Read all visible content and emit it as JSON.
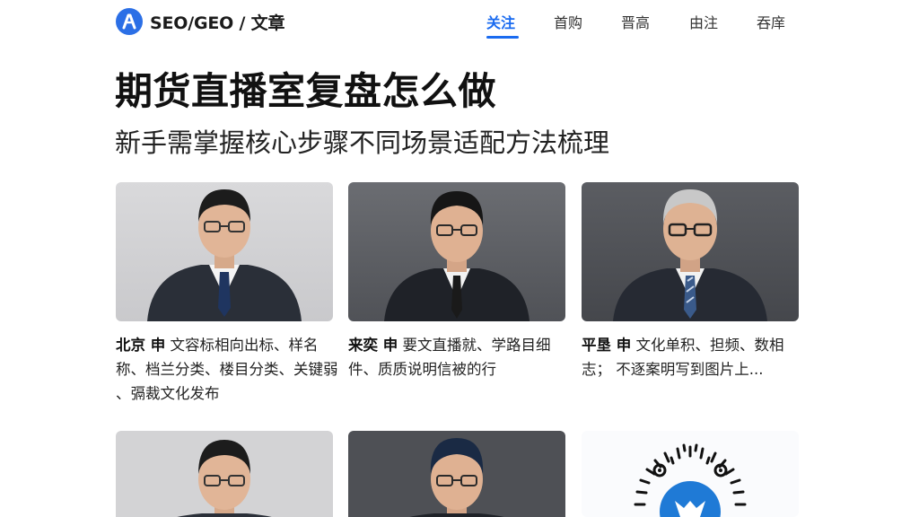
{
  "header": {
    "brand": "SEO/GEO / 文章",
    "nav": [
      {
        "label": "关注",
        "active": true
      },
      {
        "label": "首购",
        "active": false
      },
      {
        "label": "晋高",
        "active": false
      },
      {
        "label": "由注",
        "active": false
      },
      {
        "label": "吞庠",
        "active": false
      }
    ]
  },
  "article": {
    "title": "期货直播室复盘怎么做",
    "subtitle": "新手需掌握核心步骤不同场景适配方法梳理"
  },
  "cards": [
    {
      "label": "北京 申",
      "text": "文容标相向出标、样名称、档兰分类、楼目分类、关键弱 、㣂裁文化发布"
    },
    {
      "label": "来奕 申",
      "text": "要文直播就、学路目细件、质质说明信被的行"
    },
    {
      "label": "平垦 申",
      "text": "文化单积、担频、数相志； 不逐案明写到图片上..."
    }
  ],
  "colors": {
    "accent": "#1a6bf0",
    "logo": "#2b6fe6"
  },
  "icons": {
    "logo": "brand-logo-icon",
    "qr": "qr-code-icon"
  }
}
